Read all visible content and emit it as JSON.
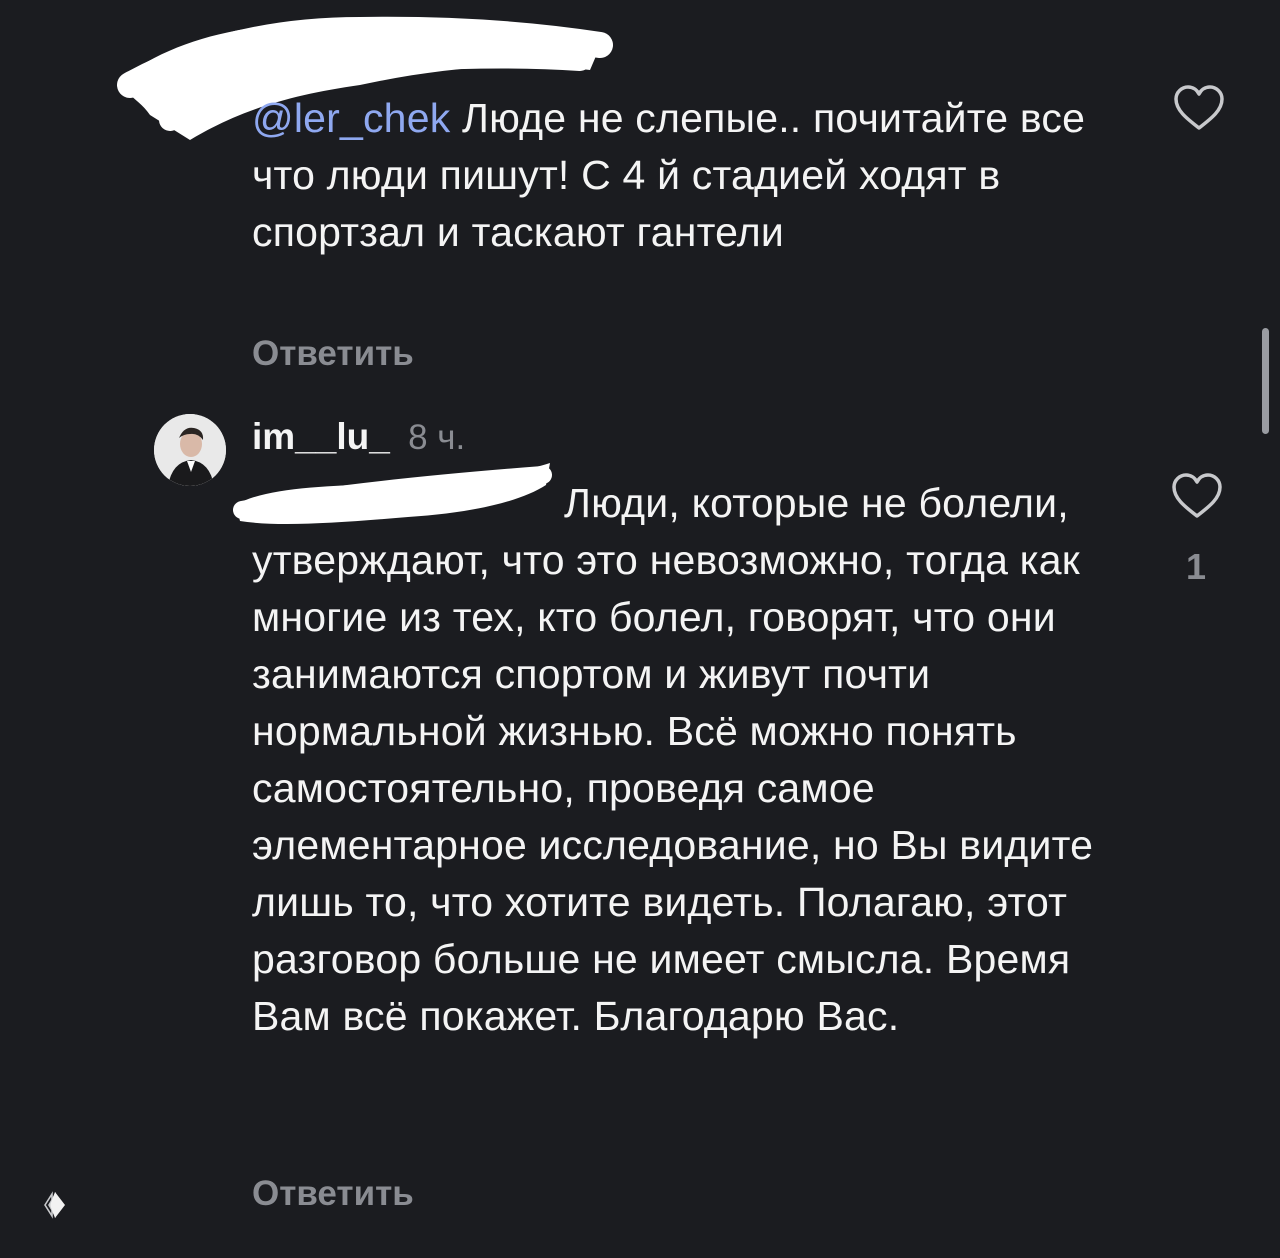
{
  "comment1": {
    "mention": "@ler_chek",
    "text": " Люде не слепые.. почитайте все что люди пишут! С 4 й стадией ходят в спортзал и таскают гантели",
    "reply_label": "Ответить"
  },
  "comment2": {
    "username": "im__lu_",
    "time": "8 ч.",
    "text": "Люди, которые не болели, утверждают, что это невозможно, тогда как многие из тех, кто болел, говорят, что они занимаются спортом и живут почти нормальной жизнью. Всё можно понять самостоятельно, проведя самое элементарное исследование, но Вы видите лишь то, что хотите видеть. Полагаю, этот разговор больше не имеет смысла. Время Вам всё покажет. Благодарю Вас.",
    "likes": "1",
    "reply_label": "Ответить"
  },
  "icons": {
    "like": "heart-outline-icon",
    "avatar": "profile-photo",
    "bottom": "app-logo-icon"
  },
  "colors": {
    "background": "#1b1c20",
    "text": "#f4f4f4",
    "mention": "#8fa8f0",
    "muted": "#8a8c92"
  }
}
